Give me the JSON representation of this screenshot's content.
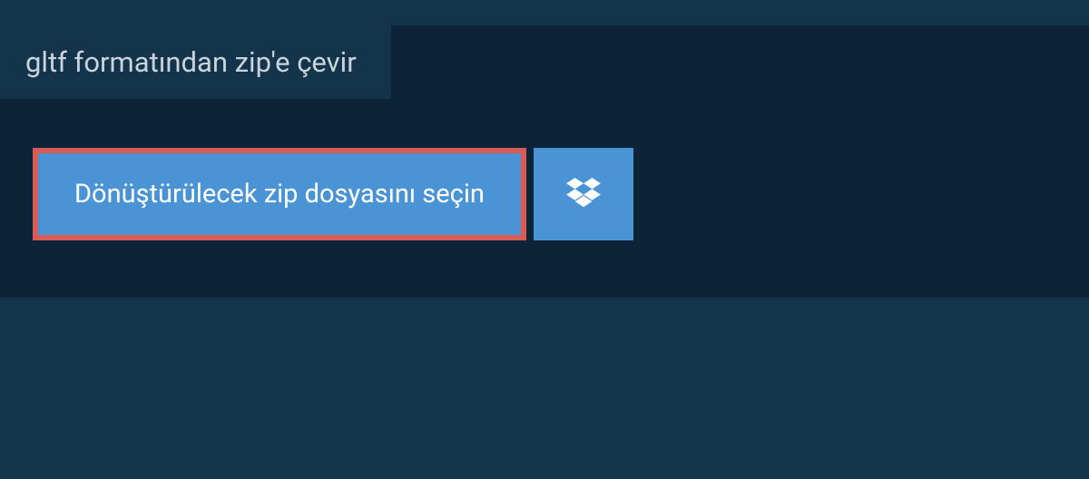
{
  "tab": {
    "label": "gltf formatından zip'e çevir"
  },
  "actions": {
    "select_file_label": "Dönüştürülecek zip dosyasını seçin"
  },
  "colors": {
    "background": "#14344b",
    "panel": "#0d2438",
    "button": "#4a94d6",
    "highlight_border": "#d85c56",
    "text_light": "#ffffff",
    "text_muted": "#c9d4dd"
  }
}
